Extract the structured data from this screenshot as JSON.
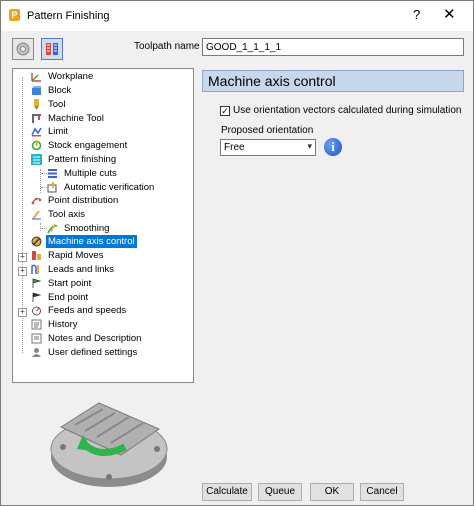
{
  "window": {
    "title": "Pattern Finishing",
    "app_icon_letter": "P",
    "help_glyph": "?",
    "close_glyph": "✕"
  },
  "toolbar": {
    "button1_icon": "pattern-settings-icon",
    "button2_icon": "toolpath-preview-icon"
  },
  "toolpath": {
    "label": "Toolpath name",
    "value": "GOOD_1_1_1_1"
  },
  "tree": {
    "items": [
      {
        "label": "Workplane",
        "icon": "workplane-icon"
      },
      {
        "label": "Block",
        "icon": "block-icon"
      },
      {
        "label": "Tool",
        "icon": "tool-icon"
      },
      {
        "label": "Machine Tool",
        "icon": "machine-tool-icon"
      },
      {
        "label": "Limit",
        "icon": "limit-icon"
      },
      {
        "label": "Stock engagement",
        "icon": "stock-engagement-icon"
      },
      {
        "label": "Pattern finishing",
        "icon": "pattern-finishing-icon"
      },
      {
        "label": "Multiple cuts",
        "icon": "multiple-cuts-icon"
      },
      {
        "label": "Automatic verification",
        "icon": "automatic-verification-icon"
      },
      {
        "label": "Point distribution",
        "icon": "point-distribution-icon"
      },
      {
        "label": "Tool axis",
        "icon": "tool-axis-icon"
      },
      {
        "label": "Smoothing",
        "icon": "smoothing-icon"
      },
      {
        "label": "Machine axis control",
        "icon": "machine-axis-control-icon"
      },
      {
        "label": "Rapid Moves",
        "icon": "rapid-moves-icon"
      },
      {
        "label": "Leads and links",
        "icon": "leads-links-icon"
      },
      {
        "label": "Start point",
        "icon": "start-point-icon"
      },
      {
        "label": "End point",
        "icon": "end-point-icon"
      },
      {
        "label": "Feeds and speeds",
        "icon": "feeds-speeds-icon"
      },
      {
        "label": "History",
        "icon": "history-icon"
      },
      {
        "label": "Notes and Description",
        "icon": "notes-icon"
      },
      {
        "label": "User defined settings",
        "icon": "user-settings-icon"
      }
    ],
    "selected": "Machine axis control",
    "expand_glyph": "+",
    "collapse_glyph": "−"
  },
  "panel": {
    "header": "Machine axis control",
    "checkbox_label": "Use orientation vectors calculated during simulation",
    "checkbox_checked": true,
    "checkbox_glyph": "✓",
    "orientation_label": "Proposed orientation",
    "orientation_value": "Free",
    "dropdown_glyph": "▾",
    "info_glyph": "i"
  },
  "illustration_icon": "rotary-table-icon",
  "buttons": {
    "calculate": "Calculate",
    "queue": "Queue",
    "ok": "OK",
    "cancel": "Cancel"
  },
  "colors": {
    "selection": "#0078d7",
    "panel_header_bg": "#c7d7ec",
    "rotation_arrow": "#2fb34a"
  }
}
